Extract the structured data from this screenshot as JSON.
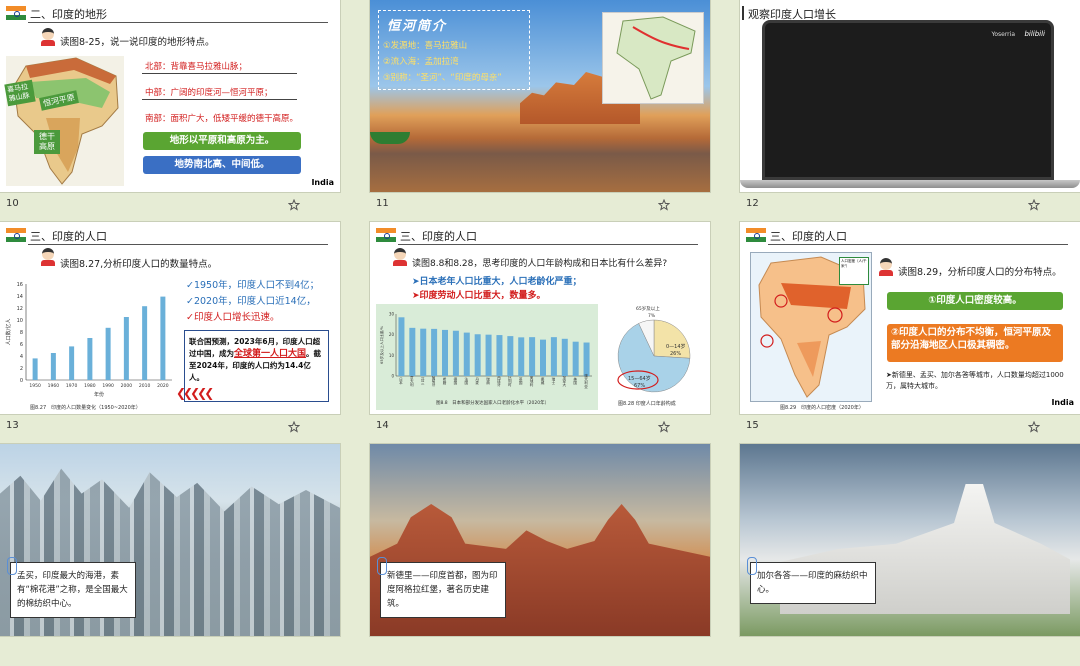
{
  "slides": [
    {
      "number": "10",
      "title": "二、印度的地形",
      "question": "读图8-25，说一说印度的地形特点。",
      "map_labels": {
        "himalaya": "喜马拉雅山脉",
        "ganges": "恒河平原",
        "deccan": "德干高原"
      },
      "points": [
        "北部：背靠喜马拉雅山脉；",
        "中部：广阔的印度河—恒河平原；",
        "南部：面积广大，低矮平缓的德干高原。"
      ],
      "btn_green": "地形以平原和高原为主。",
      "btn_blue": "地势南北高、中间低。",
      "logo": "India"
    },
    {
      "number": "11",
      "box_title": "恒河简介",
      "items": [
        "①发源地：喜马拉雅山",
        "②流入海：孟加拉湾",
        "③别称：“圣河”、“印度的母亲”"
      ]
    },
    {
      "number": "12",
      "title": "观察印度人口增长",
      "video_brand": "Yoserria",
      "video_logo": "bilibili"
    },
    {
      "number": "13",
      "title": "三、印度的人口",
      "question": "读图8.27,分析印度人口的数量特点。",
      "facts": [
        "✓1950年，印度人口不到4亿；",
        "✓2020年，印度人口近14亿，",
        "✓印度人口增长迅速。"
      ],
      "box_text_1": "联合国预测，2023年6月，印度人口超过中国，成为",
      "box_emph": "全球第一人口大国",
      "box_text_2": "。截至2024年，印度的人口约为14.4亿人。",
      "caption": "图8.27　印度的人口数量变化（1950~2020年）"
    },
    {
      "number": "14",
      "title": "三、印度的人口",
      "question": "读图8.8和8.28，思考印度的人口年龄构成和日本比有什么差异?",
      "points": [
        "➤日本老年人口比重大，人口老龄化严重；",
        "➤印度劳动人口比重大，数量多。"
      ],
      "bar_caption": "图8.8　日本和部分发达国家人口老龄化水平（2020年）",
      "pie_caption": "图8.28 印度人口年龄构成",
      "pie_labels": [
        "65岁及以上",
        "7%",
        "0—14岁",
        "26%",
        "15—64岁",
        "67%"
      ]
    },
    {
      "number": "15",
      "title": "三、印度的人口",
      "question": "读图8.29，分析印度人口的分布特点。",
      "btn_green": "①印度人口密度较高。",
      "btn_orange": "②印度人口的分布不均衡，恒河平原及部分沿海地区人口极其稠密。",
      "note": "➤新德里、孟买、加尔各答等城市，人口数量均超过1000万，属特大城市。",
      "caption": "图8.29　印度的人口密度（2020年）",
      "legend_title": "人口密度（人/千米²）",
      "logo": "India"
    },
    {
      "number": "16",
      "caption": "孟买，印度最大的海港，素有“棉花港”之称，是全国最大的棉纺织中心。"
    },
    {
      "number": "17",
      "caption": "新德里——印度首都，图为印度阿格拉红堡，著名历史建筑。"
    },
    {
      "number": "18",
      "caption": "加尔各答——印度的麻纺织中心。"
    }
  ],
  "chart_data": [
    {
      "type": "bar",
      "title": "",
      "categories": [
        "1950",
        "1960",
        "1970",
        "1980",
        "1990",
        "2000",
        "2010",
        "2020"
      ],
      "values": [
        3.6,
        4.5,
        5.6,
        7.0,
        8.7,
        10.5,
        12.3,
        13.9
      ],
      "ylabel": "人口数/亿人",
      "xlabel": "年份",
      "ylim": [
        0,
        16
      ],
      "yticks": [
        "0",
        "2",
        "4",
        "6",
        "8",
        "10",
        "12",
        "14",
        "16"
      ]
    },
    {
      "type": "bar",
      "title": "",
      "categories": [
        "日本",
        "意大利",
        "芬兰",
        "葡萄牙",
        "希腊",
        "德国",
        "法国",
        "丹麦",
        "瑞典",
        "西班牙",
        "比利时",
        "英国",
        "奥地利",
        "挪威",
        "瑞士",
        "加拿大",
        "美国",
        "澳大利亚"
      ],
      "values": [
        28.4,
        23.3,
        22.9,
        22.8,
        22.3,
        21.9,
        21.0,
        20.2,
        20.0,
        19.8,
        19.3,
        18.7,
        18.8,
        17.6,
        18.8,
        18.0,
        16.6,
        16.2
      ],
      "ylabel": "65岁及以上人口比重/%",
      "ylim": [
        0,
        30
      ]
    },
    {
      "type": "pie",
      "title": "",
      "categories": [
        "0—14岁",
        "15—64岁",
        "65岁及以上"
      ],
      "values": [
        26,
        67,
        7
      ]
    }
  ],
  "colors": {
    "bar_blue": "#6ab0d9",
    "green_btn": "#5aa532",
    "blue_btn": "#3a6fc4",
    "orange_btn": "#ec7a22"
  }
}
